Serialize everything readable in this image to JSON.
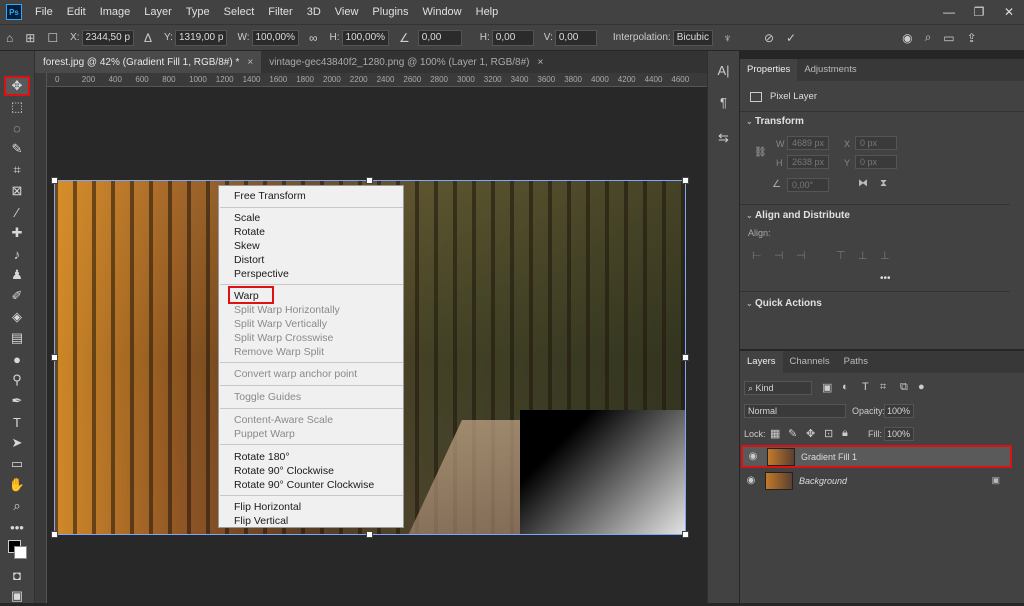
{
  "menubar": {
    "logo": "Ps",
    "items": [
      "File",
      "Edit",
      "Image",
      "Layer",
      "Type",
      "Select",
      "Filter",
      "3D",
      "View",
      "Plugins",
      "Window",
      "Help"
    ],
    "controls": [
      "—",
      "❐",
      "✕"
    ]
  },
  "options": {
    "x_label": "X:",
    "x_value": "2344,50 p",
    "y_label": "Y:",
    "y_value": "1319,00 p",
    "w_label": "W:",
    "w_value": "100,00%",
    "h_label": "H:",
    "h_value": "100,00%",
    "angle_value": "0,00",
    "hskew_label": "H:",
    "hskew_value": "0,00",
    "vskew_label": "V:",
    "vskew_value": "0,00",
    "interp_label": "Interpolation:",
    "interp_value": "Bicubic"
  },
  "tabs": [
    {
      "label": "forest.jpg @ 42% (Gradient Fill 1, RGB/8#) *",
      "close": "×"
    },
    {
      "label": "vintage-gec43840f2_1280.png @ 100% (Layer 1, RGB/8#)",
      "close": "×"
    }
  ],
  "ruler": [
    "0",
    "200",
    "400",
    "600",
    "800",
    "1000",
    "1200",
    "1400",
    "1600",
    "1800",
    "2000",
    "2200",
    "2400",
    "2600",
    "2800",
    "3000",
    "3200",
    "3400",
    "3600",
    "3800",
    "4000",
    "4200",
    "4400",
    "4600"
  ],
  "context_menu": {
    "free_transform": "Free Transform",
    "scale": "Scale",
    "rotate": "Rotate",
    "skew": "Skew",
    "distort": "Distort",
    "perspective": "Perspective",
    "warp": "Warp",
    "split_h": "Split Warp Horizontally",
    "split_v": "Split Warp Vertically",
    "split_c": "Split Warp Crosswise",
    "remove_split": "Remove Warp Split",
    "convert_anchor": "Convert warp anchor point",
    "toggle_guides": "Toggle Guides",
    "content_aware": "Content-Aware Scale",
    "puppet": "Puppet Warp",
    "rot180": "Rotate 180°",
    "rot90cw": "Rotate 90° Clockwise",
    "rot90ccw": "Rotate 90° Counter Clockwise",
    "flip_h": "Flip Horizontal",
    "flip_v": "Flip Vertical"
  },
  "properties": {
    "tabs": [
      "Properties",
      "Adjustments"
    ],
    "layer_type": "Pixel Layer",
    "transform_title": "Transform",
    "w_label": "W",
    "w_value": "4689 px",
    "x_label": "X",
    "x_value": "0 px",
    "h_label": "H",
    "h_value": "2638 px",
    "y_label": "Y",
    "y_value": "0 px",
    "angle_value": "0,00°",
    "align_title": "Align and Distribute",
    "align_label": "Align:",
    "more": "•••",
    "quick_title": "Quick Actions"
  },
  "layers": {
    "tabs": [
      "Layers",
      "Channels",
      "Paths"
    ],
    "kind": "Kind",
    "blend_mode": "Normal",
    "opacity_label": "Opacity:",
    "opacity_value": "100%",
    "lock_label": "Lock:",
    "fill_label": "Fill:",
    "fill_value": "100%",
    "items": [
      {
        "name": "Gradient Fill 1"
      },
      {
        "name": "Background"
      }
    ]
  }
}
